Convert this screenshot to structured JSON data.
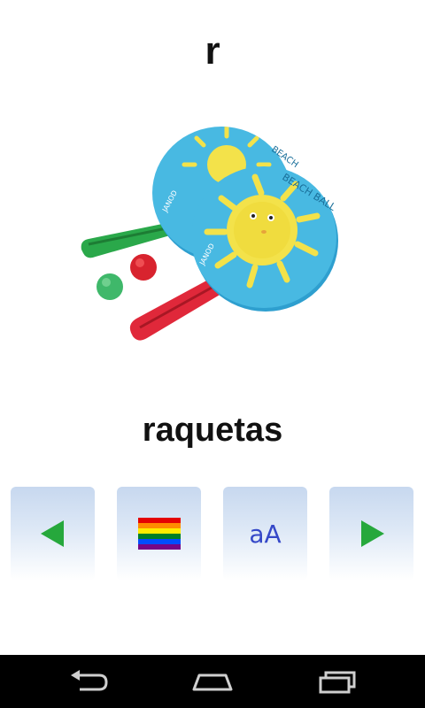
{
  "card": {
    "letter": "r",
    "word": "raquetas",
    "image": {
      "subject": "beach paddles with balls",
      "paddle_text_1": "BEACH",
      "paddle_text_2": "BEACH BALL",
      "brand_text": "JANOD"
    }
  },
  "controls": {
    "case_toggle_label": "aA",
    "prev_icon": "triangle-left-icon",
    "next_icon": "triangle-right-icon",
    "flag_icon": "rainbow-flag-icon"
  },
  "colors": {
    "arrow_green": "#26a83c",
    "case_text_blue": "#3548c8",
    "button_gradient_top": "#c7d8ef",
    "paddle_blue": "#3fb3df",
    "paddle_handle_red": "#e0283a",
    "paddle_handle_green": "#2aa84a",
    "sun_yellow": "#f3e24a"
  },
  "system_nav": {
    "back_icon": "back-icon",
    "home_icon": "home-icon",
    "recents_icon": "recents-icon"
  }
}
